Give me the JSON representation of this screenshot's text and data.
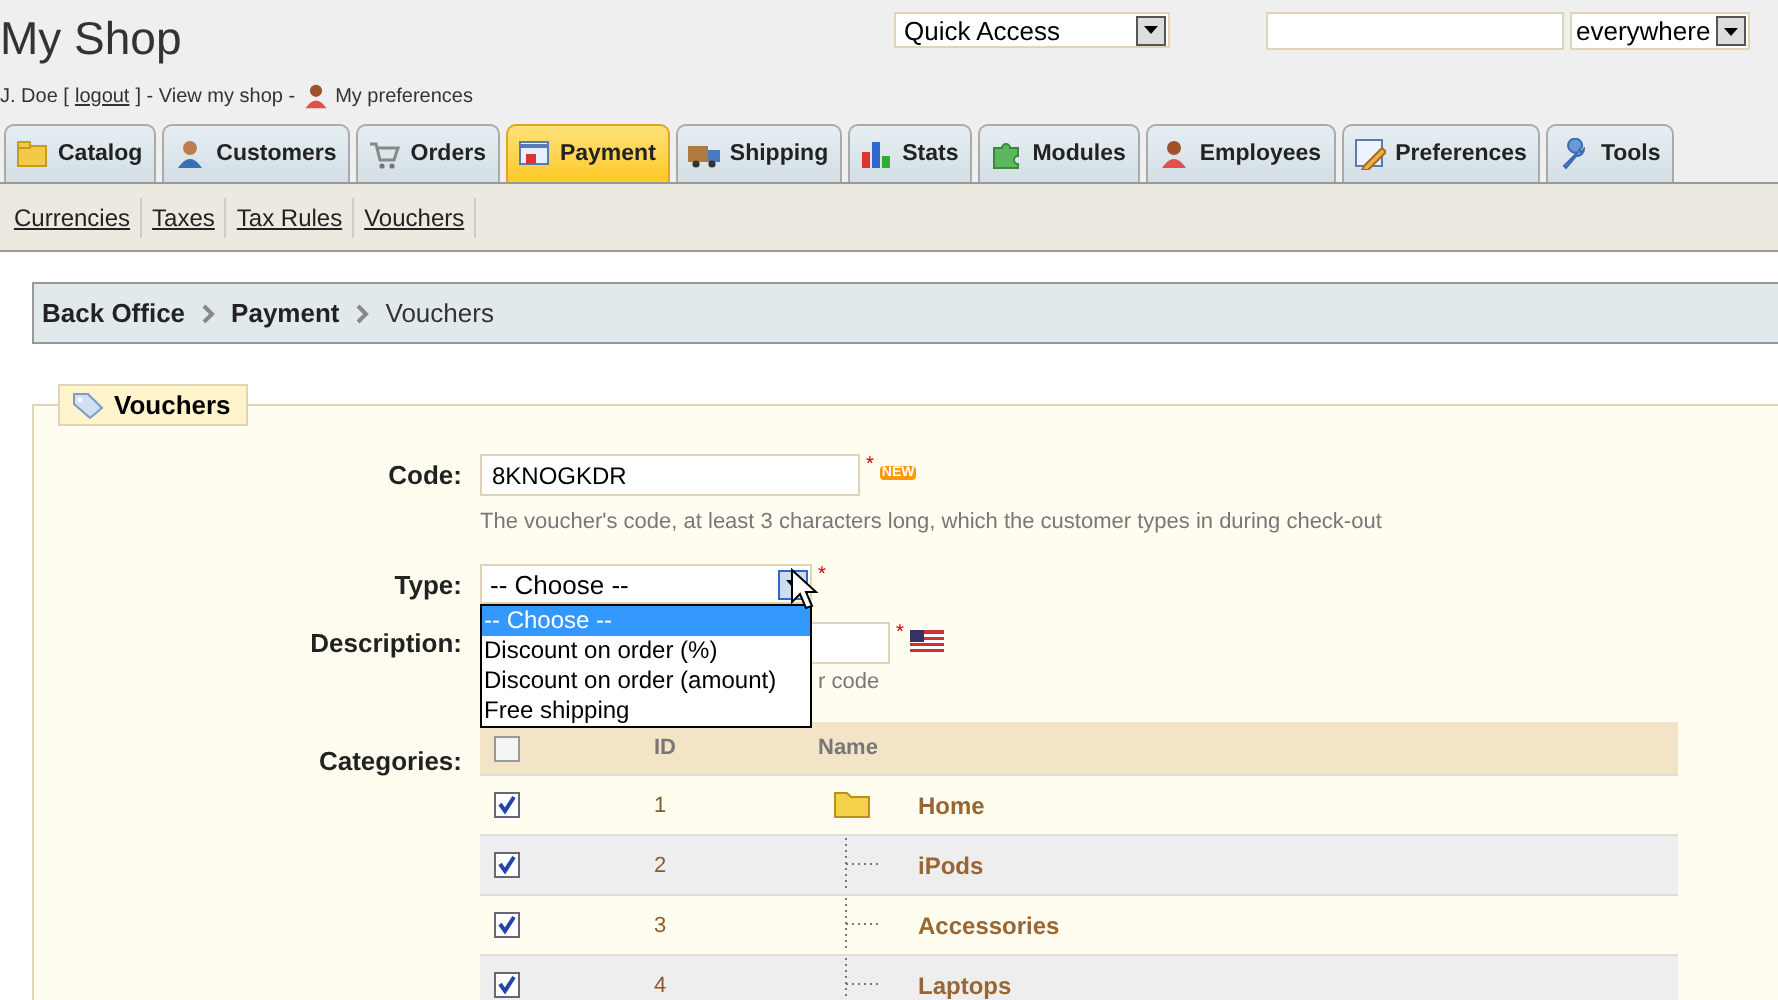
{
  "header": {
    "title": "My Shop",
    "quick_access": "Quick Access",
    "search_scope": "everywhere",
    "user_line": {
      "name": "J. Doe [",
      "logout": "logout",
      "middle": "] - View my shop -",
      "preferences": "My preferences"
    }
  },
  "tabs": [
    {
      "label": "Catalog",
      "selected": false
    },
    {
      "label": "Customers",
      "selected": false
    },
    {
      "label": "Orders",
      "selected": false
    },
    {
      "label": "Payment",
      "selected": true
    },
    {
      "label": "Shipping",
      "selected": false
    },
    {
      "label": "Stats",
      "selected": false
    },
    {
      "label": "Modules",
      "selected": false
    },
    {
      "label": "Employees",
      "selected": false
    },
    {
      "label": "Preferences",
      "selected": false
    },
    {
      "label": "Tools",
      "selected": false
    }
  ],
  "subtabs": [
    "Currencies",
    "Taxes",
    "Tax Rules",
    "Vouchers"
  ],
  "breadcrumb": [
    "Back Office",
    "Payment",
    "Vouchers"
  ],
  "form": {
    "legend": "Vouchers",
    "code": {
      "label": "Code:",
      "value": "8KNOGKDR",
      "required": "*",
      "badge": "NEW",
      "hint": "The voucher's code, at least 3 characters long, which the customer types in during check-out"
    },
    "type": {
      "label": "Type:",
      "value": "-- Choose --",
      "required": "*",
      "expanded": true,
      "options": [
        {
          "label": "-- Choose --",
          "selected": true
        },
        {
          "label": "Discount on order (%)",
          "selected": false
        },
        {
          "label": "Discount on order (amount)",
          "selected": false
        },
        {
          "label": "Free shipping",
          "selected": false
        }
      ]
    },
    "description": {
      "label": "Description:",
      "required": "*",
      "hint": "r code"
    },
    "categories": {
      "label": "Categories:",
      "all_checked": false,
      "columns": [
        "ID",
        "Name"
      ],
      "rows": [
        {
          "id": "1",
          "name": "Home",
          "checked": true,
          "children": [
            {
              "id": "2",
              "name": "iPods",
              "checked": true
            },
            {
              "id": "3",
              "name": "Accessories",
              "checked": true
            },
            {
              "id": "4",
              "name": "Laptops",
              "checked": true
            }
          ]
        }
      ]
    }
  }
}
